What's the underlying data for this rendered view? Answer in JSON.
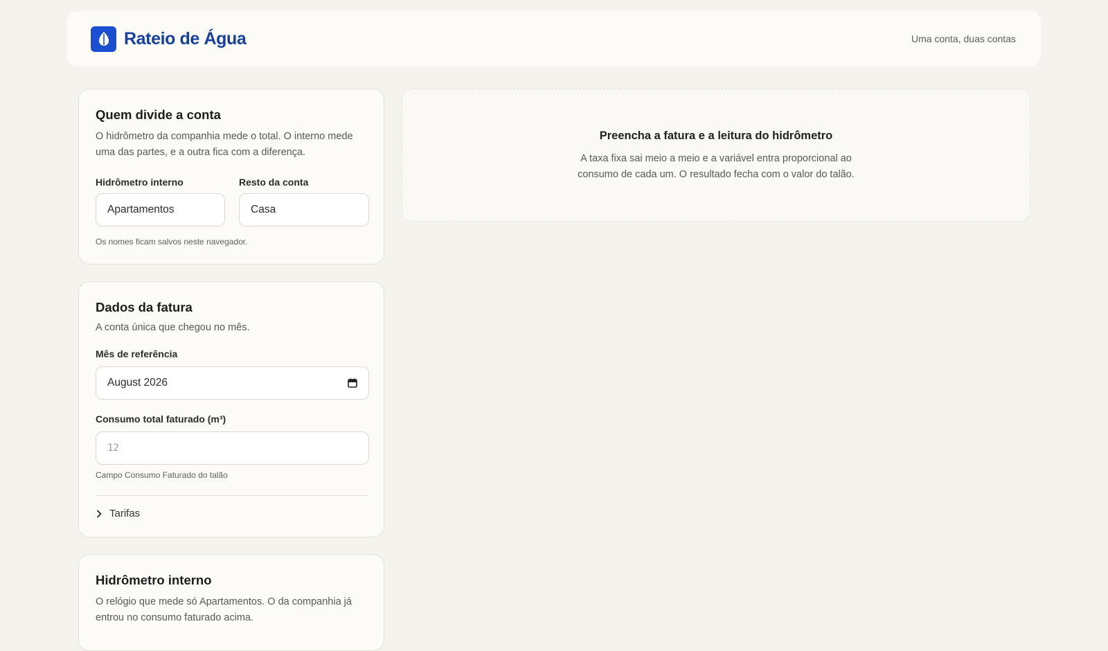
{
  "header": {
    "brand": "Rateio de Água",
    "tagline": "Uma conta, duas contas",
    "logo_icon": "water-drop-icon",
    "accent_color": "#1a4fd1"
  },
  "names_card": {
    "title": "Quem divide a conta",
    "description": "O hidrômetro da companhia mede o total. O interno mede uma das partes, e a outra fica com a diferença.",
    "internal_label": "Hidrômetro interno",
    "internal_value": "Apartamentos",
    "rest_label": "Resto da conta",
    "rest_value": "Casa",
    "hint": "Os nomes ficam salvos neste navegador."
  },
  "invoice_card": {
    "title": "Dados da fatura",
    "description": "A conta única que chegou no mês.",
    "month_label": "Mês de referência",
    "month_value": "August 2026",
    "consumption_label": "Consumo total faturado (m³)",
    "consumption_placeholder": "12",
    "consumption_hint": "Campo Consumo Faturado do talão",
    "tariffs_label": "Tarifas"
  },
  "meter_card": {
    "title": "Hidrômetro interno",
    "description": "O relógio que mede só Apartamentos. O da companhia já entrou no consumo faturado acima."
  },
  "result": {
    "title": "Preencha a fatura e a leitura do hidrômetro",
    "description": "A taxa fixa sai meio a meio e a variável entra proporcional ao consumo de cada um. O resultado fecha com o valor do talão."
  }
}
